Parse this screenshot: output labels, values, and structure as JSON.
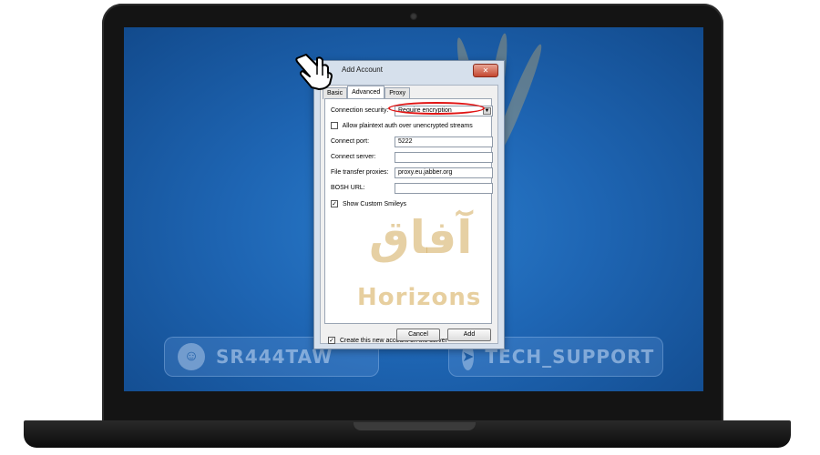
{
  "watermark": {
    "arabic": "آفاق",
    "latin": "Horizons",
    "left_pill": "SR444TAW",
    "right_pill": "TECH_SUPPORT"
  },
  "dialog": {
    "title": "Add Account",
    "close_icon": "close-x",
    "tabs": [
      "Basic",
      "Advanced",
      "Proxy"
    ],
    "active_tab": "Advanced",
    "connection_security_label": "Connection security:",
    "connection_security_value": "Require encryption",
    "allow_plaintext_label": "Allow plaintext auth over unencrypted streams",
    "allow_plaintext_checked": false,
    "connect_port_label": "Connect port:",
    "connect_port_value": "5222",
    "connect_server_label": "Connect server:",
    "connect_server_value": "",
    "file_transfer_label": "File transfer proxies:",
    "file_transfer_value": "proxy.eu.jabber.org",
    "bosh_label": "BOSH URL:",
    "bosh_value": "",
    "show_smileys_label": "Show Custom Smileys",
    "show_smileys_checked": true,
    "create_account_label": "Create this new account on the server",
    "create_account_checked": true,
    "cancel_label": "Cancel",
    "add_label": "Add"
  },
  "colors": {
    "highlight": "#e01515",
    "desktop": "#1e65b3"
  }
}
